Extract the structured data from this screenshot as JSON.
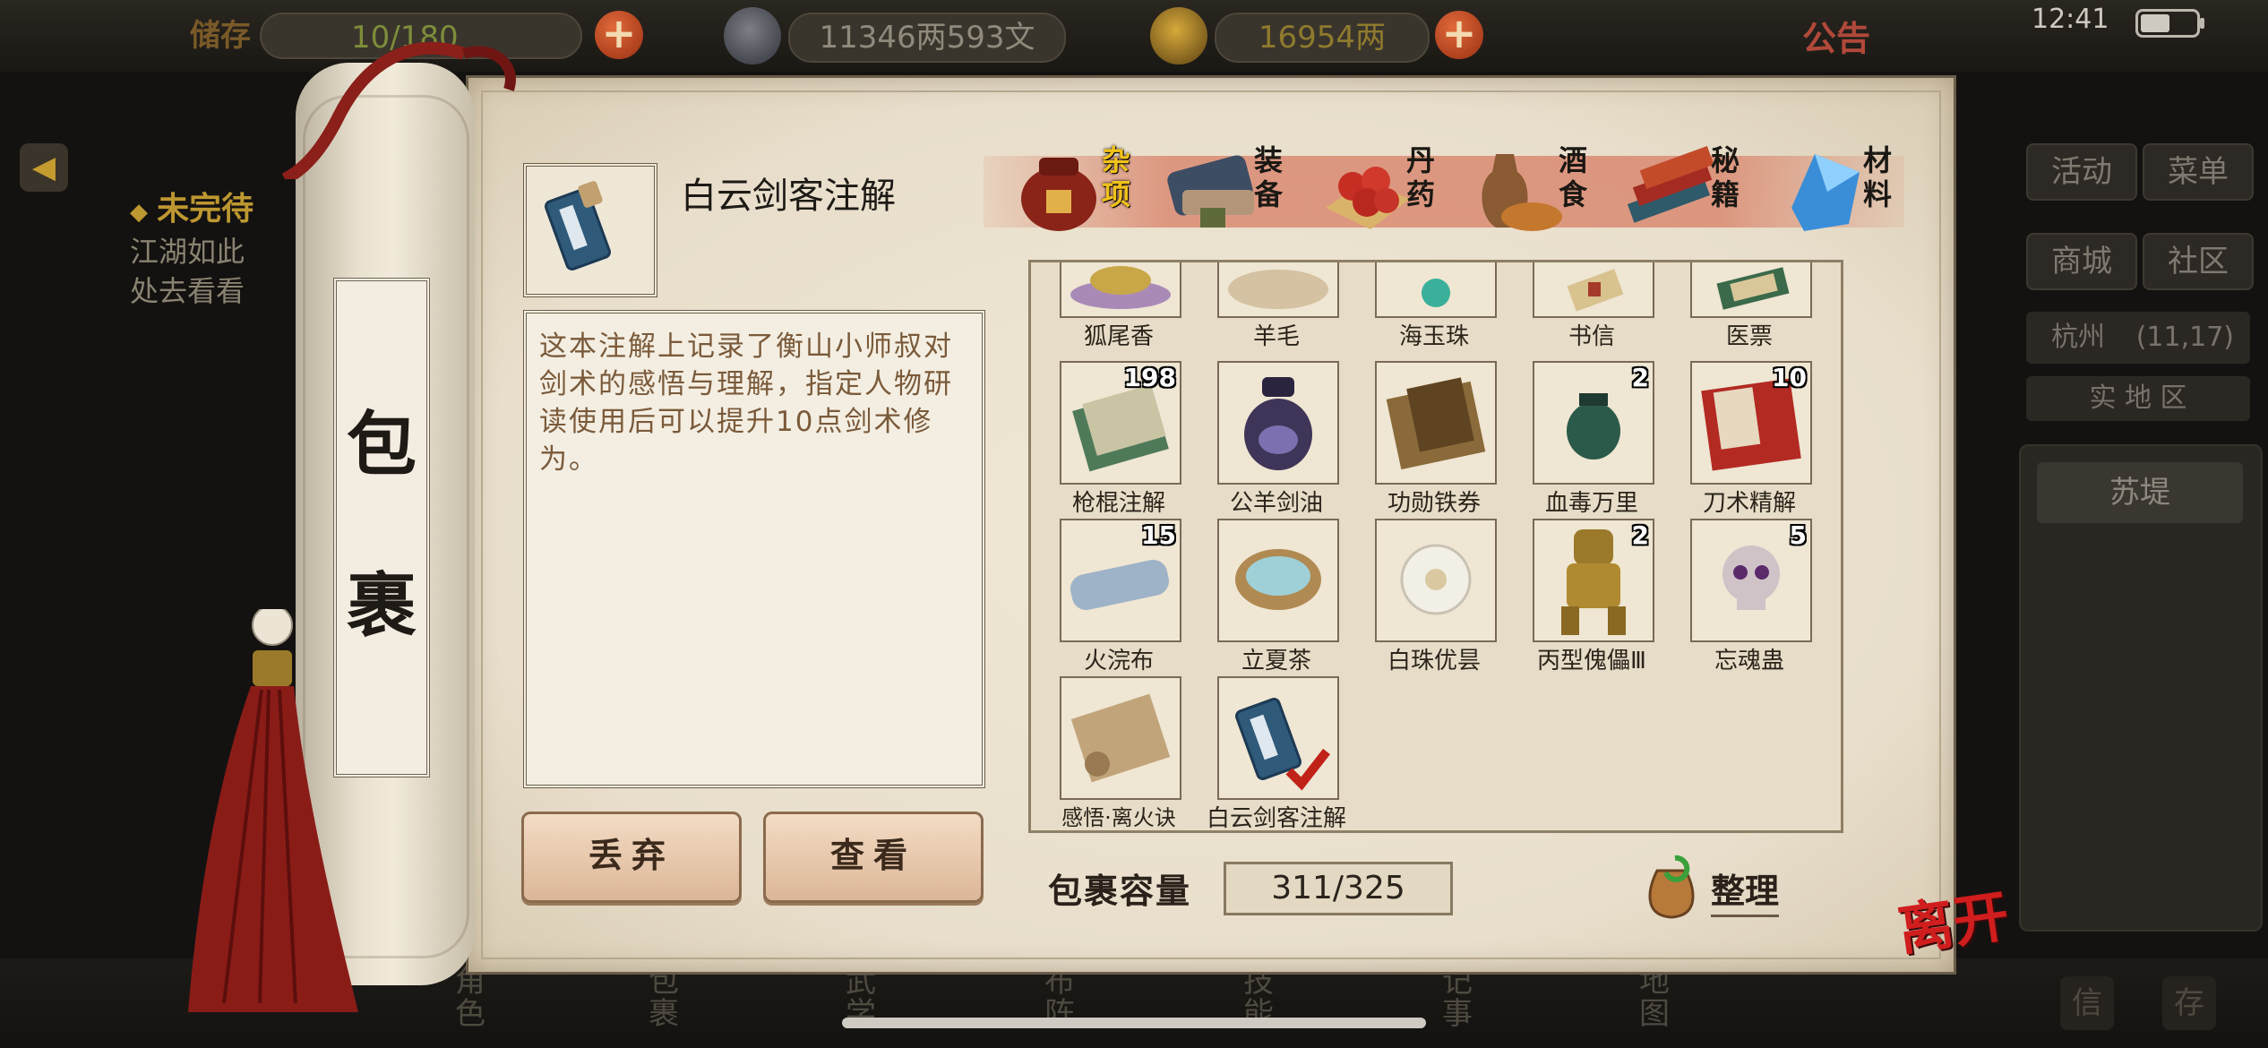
{
  "top_bar": {
    "storage_label": "储存",
    "storage_value": "10/180",
    "silver_value": "11346两593文",
    "gold_value": "16954两",
    "notice_label": "公告",
    "clock": "12:41"
  },
  "left_hud": {
    "quest_title": "未完待",
    "quest_line1": "江湖如此",
    "quest_line2": "处去看看"
  },
  "right_hud": {
    "activity_label": "活动",
    "menu_label": "菜单",
    "shop_label": "商城",
    "community_label": "社区",
    "location_city": "杭州",
    "location_coords": "(11,17)",
    "location_sub": "实  地  区",
    "place_name": "苏堤"
  },
  "bottom_nav": [
    {
      "label": "角色"
    },
    {
      "label": "包裹"
    },
    {
      "label": "武学"
    },
    {
      "label": "布阵"
    },
    {
      "label": "技能"
    },
    {
      "label": "记事"
    },
    {
      "label": "地图"
    }
  ],
  "bottom_right": {
    "label_a": "信",
    "label_b": "存"
  },
  "scroll_title": [
    "包",
    "裹"
  ],
  "selected_item": {
    "name": "白云剑客注解",
    "description": "这本注解上记录了衡山小师叔对剑术的感悟与理解，指定人物研读使用后可以提升10点剑术修为。"
  },
  "buttons": {
    "discard": "丢弃",
    "view": "查看"
  },
  "categories": [
    {
      "label": "杂项",
      "active": true
    },
    {
      "label": "装备",
      "active": false
    },
    {
      "label": "丹药",
      "active": false
    },
    {
      "label": "酒食",
      "active": false
    },
    {
      "label": "秘籍",
      "active": false
    },
    {
      "label": "材料",
      "active": false
    }
  ],
  "items": [
    {
      "name": "狐尾香",
      "qty": ""
    },
    {
      "name": "羊毛",
      "qty": ""
    },
    {
      "name": "海玉珠",
      "qty": ""
    },
    {
      "name": "书信",
      "qty": ""
    },
    {
      "name": "医票",
      "qty": ""
    },
    {
      "name": "枪棍注解",
      "qty": "198"
    },
    {
      "name": "公羊剑油",
      "qty": ""
    },
    {
      "name": "功勋铁券",
      "qty": ""
    },
    {
      "name": "血毒万里",
      "qty": "2"
    },
    {
      "name": "刀术精解",
      "qty": "10"
    },
    {
      "name": "火浣布",
      "qty": "15"
    },
    {
      "name": "立夏茶",
      "qty": ""
    },
    {
      "name": "白珠优昙",
      "qty": ""
    },
    {
      "name": "丙型傀儡Ⅲ",
      "qty": "2"
    },
    {
      "name": "忘魂蛊",
      "qty": "5"
    },
    {
      "name": "感悟·离火诀",
      "qty": ""
    },
    {
      "name": "白云剑客注解",
      "qty": ""
    }
  ],
  "capacity": {
    "label": "包裹容量",
    "value": "311/325"
  },
  "sort_label": "整理",
  "leave_label": "离开",
  "colors": {
    "active_tab": "#f1c21b",
    "leave": "#d01d1d",
    "parchment": "#ece3d0"
  }
}
